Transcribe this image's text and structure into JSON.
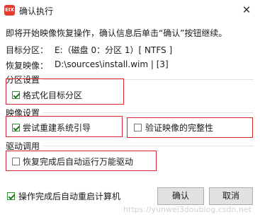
{
  "window": {
    "title": "确认执行",
    "app_icon_text": "EIX",
    "close_glyph": "✕"
  },
  "intro_text": "即将开始映像恢复操作，确认信息后单击“确认”按钮继续。",
  "target_partition": {
    "label": "目标分区：",
    "value": "E:（磁盘 0：分区 1）[ NTFS ]"
  },
  "recovery_image": {
    "label": "恢复映像：",
    "value": "D:\\sources\\install.wim | [3]"
  },
  "partition_settings": {
    "heading": "分区设置",
    "format_checkbox": {
      "label": "格式化目标分区",
      "checked": true
    }
  },
  "image_settings": {
    "heading": "映像设置",
    "rebuild_boot_checkbox": {
      "label": "尝试重建系统引导",
      "checked": true
    },
    "verify_checkbox": {
      "label": "验证映像的完整性",
      "checked": false
    }
  },
  "driver_settings": {
    "heading": "驱动调用",
    "universal_driver_checkbox": {
      "label": "恢复完成后自动运行万能驱动",
      "checked": false
    }
  },
  "footer": {
    "restart_checkbox": {
      "label": "操作完成后自动重启计算机",
      "checked": true
    },
    "confirm_label": "确认",
    "cancel_label": "取消"
  },
  "watermark": "https://yunwei3doublog.csdn.net",
  "colors": {
    "highlight_box": "#d9262c",
    "check_mark": "#1f7a1f",
    "app_icon": "#e33b2f"
  }
}
